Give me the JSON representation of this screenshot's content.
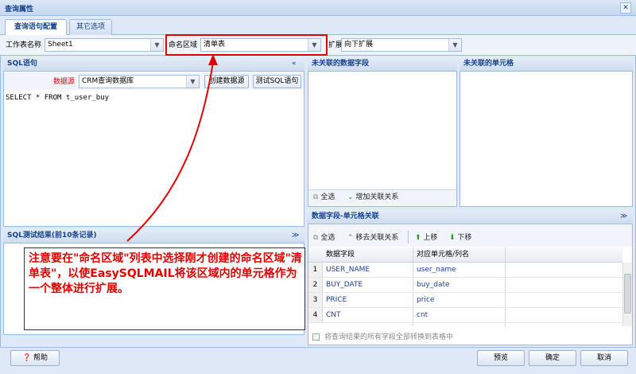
{
  "window": {
    "title": "查询属性",
    "close_glyph": "✕"
  },
  "tabs": [
    {
      "label": "查询语句配置",
      "active": true
    },
    {
      "label": "其它选项",
      "active": false
    }
  ],
  "toolbar": {
    "sheet_label": "工作表名称",
    "sheet_value": "Sheet1",
    "range_label": "命名区域",
    "range_value": "清单表",
    "expand_label": "扩展",
    "expand_value": "向下扩展"
  },
  "sql_panel": {
    "title": "SQL语句",
    "collapse_glyph": "«",
    "datasource_label": "数据源",
    "datasource_value": "CRM查询数据库",
    "create_btn": "创建数据源",
    "test_btn": "测试SQL语句",
    "sql_text": "SELECT * FROM t_user_buy"
  },
  "test_panel": {
    "title": "SQL测试结果(前10条记录)",
    "collapse_glyph": "≫"
  },
  "unlinked_fields": {
    "title": "未关联的数据字段",
    "select_all": "全选",
    "add_relation": "增加关联关系"
  },
  "unlinked_cells": {
    "title": "未关联的单元格"
  },
  "mapping": {
    "title": "数据字段-单元格关联",
    "collapse_glyph": "≫",
    "select_all": "全选",
    "remove_relation": "移去关联关系",
    "move_up": "上移",
    "move_down": "下移",
    "col_field": "数据字段",
    "col_cell": "对应单元格/列名",
    "rows": [
      {
        "num": "1",
        "field": "USER_NAME",
        "cell": "user_name"
      },
      {
        "num": "2",
        "field": "BUY_DATE",
        "cell": "buy_date"
      },
      {
        "num": "3",
        "field": "PRICE",
        "cell": "price"
      },
      {
        "num": "4",
        "field": "CNT",
        "cell": "cnt"
      }
    ],
    "checkbox_label": "将查询结果的所有字段全部转换到表格中",
    "checkbox_checked": false
  },
  "footer": {
    "help": "帮助",
    "preview": "预览",
    "ok": "确定",
    "cancel": "取消"
  },
  "annotation": {
    "text": "注意要在\"命名区域\"列表中选择刚才创建的命名区域\"清单表\"，以使EasySQLMAIL将该区域内的单元格作为一个整体进行扩展。"
  },
  "colors": {
    "accent": "#15428b",
    "annotation": "#e00000"
  }
}
